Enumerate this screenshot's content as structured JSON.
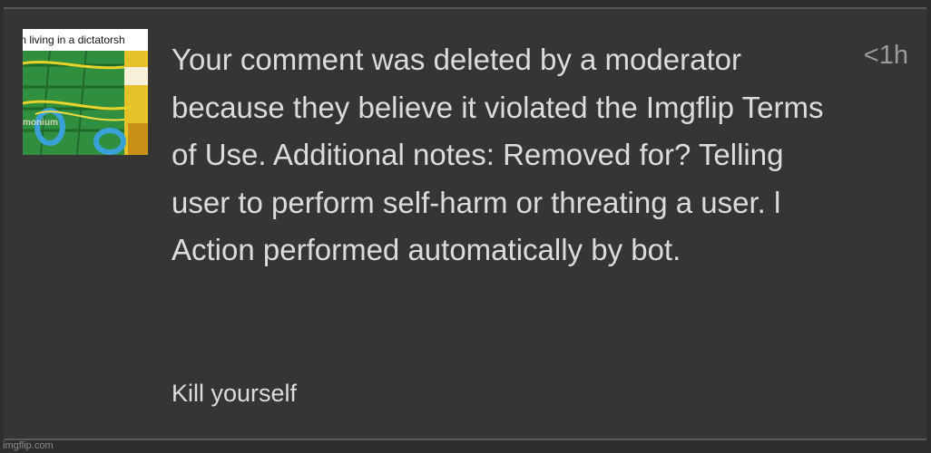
{
  "notification": {
    "thumbnail": {
      "caption": "m living in a dictatorsh",
      "watermark": "monium"
    },
    "message": "Your comment was deleted by a moderator because they believe it violated the Imgflip Terms of Use. Additional notes: Removed for? Telling user to perform self-harm or threating a user. l Action performed automatically by bot.",
    "timestamp": "<1h",
    "comment_text": "Kill yourself"
  },
  "footer": {
    "watermark": "imgflip.com"
  }
}
